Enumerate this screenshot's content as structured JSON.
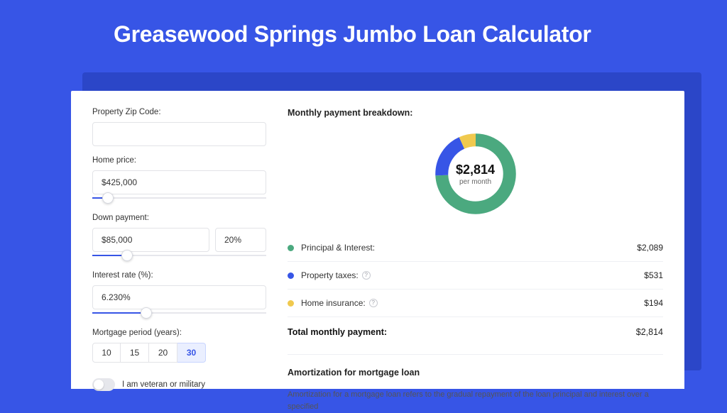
{
  "title": "Greasewood Springs Jumbo Loan Calculator",
  "form": {
    "zip_label": "Property Zip Code:",
    "zip_value": "",
    "home_price_label": "Home price:",
    "home_price_value": "$425,000",
    "home_price_slider_pct": 9,
    "down_payment_label": "Down payment:",
    "down_payment_value": "$85,000",
    "down_payment_pct_value": "20%",
    "down_payment_slider_pct": 20,
    "interest_label": "Interest rate (%):",
    "interest_value": "6.230%",
    "interest_slider_pct": 31,
    "period_label": "Mortgage period (years):",
    "periods": [
      "10",
      "15",
      "20",
      "30"
    ],
    "period_active_index": 3,
    "veteran_label": "I am veteran or military",
    "veteran_on": false
  },
  "breakdown": {
    "title": "Monthly payment breakdown:",
    "donut_value": "$2,814",
    "donut_sub": "per month",
    "items": [
      {
        "color": "#4ba97f",
        "label": "Principal & Interest:",
        "value": "$2,089",
        "info": false,
        "share": 74.2
      },
      {
        "color": "#3755e6",
        "label": "Property taxes:",
        "value": "$531",
        "info": true,
        "share": 18.9
      },
      {
        "color": "#f0c94e",
        "label": "Home insurance:",
        "value": "$194",
        "info": true,
        "share": 6.9
      }
    ],
    "total_label": "Total monthly payment:",
    "total_value": "$2,814"
  },
  "amort": {
    "title": "Amortization for mortgage loan",
    "desc": "Amortization for a mortgage loan refers to the gradual repayment of the loan principal and interest over a specified"
  },
  "chart_data": {
    "type": "pie",
    "title": "Monthly payment breakdown",
    "series": [
      {
        "name": "Principal & Interest",
        "value": 2089,
        "color": "#4ba97f"
      },
      {
        "name": "Property taxes",
        "value": 531,
        "color": "#3755e6"
      },
      {
        "name": "Home insurance",
        "value": 194,
        "color": "#f0c94e"
      }
    ],
    "total": 2814,
    "center_label": "$2,814",
    "center_sub": "per month"
  }
}
